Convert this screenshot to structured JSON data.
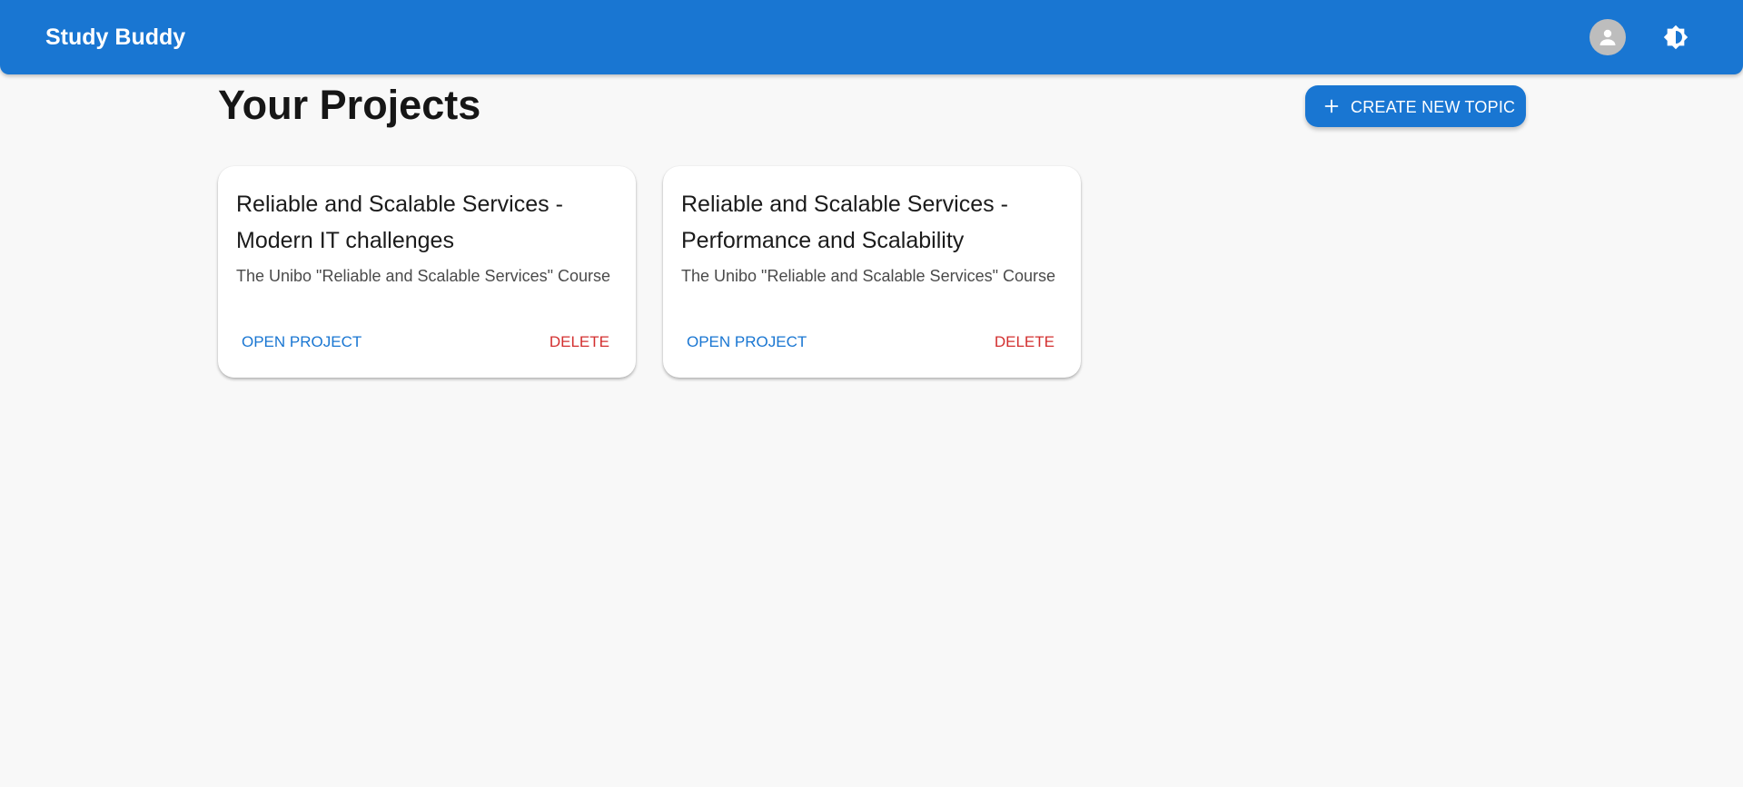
{
  "app": {
    "title": "Study Buddy",
    "accent_color": "#1976d2",
    "danger_color": "#d32f2f"
  },
  "header": {
    "avatar_icon": "account-circle-icon",
    "theme_icon": "brightness-icon"
  },
  "main": {
    "page_title": "Your Projects",
    "create_button": {
      "icon": "plus-icon",
      "label": "CREATE NEW TOPIC"
    },
    "projects": [
      {
        "title": "Reliable and Scalable Services - Modern IT challenges",
        "description": "The Unibo \"Reliable and Scalable Services\" Course",
        "open_label": "OPEN PROJECT",
        "delete_label": "DELETE"
      },
      {
        "title": "Reliable and Scalable Services - Performance and Scalability",
        "description": "The Unibo \"Reliable and Scalable Services\" Course",
        "open_label": "OPEN PROJECT",
        "delete_label": "DELETE"
      }
    ]
  }
}
